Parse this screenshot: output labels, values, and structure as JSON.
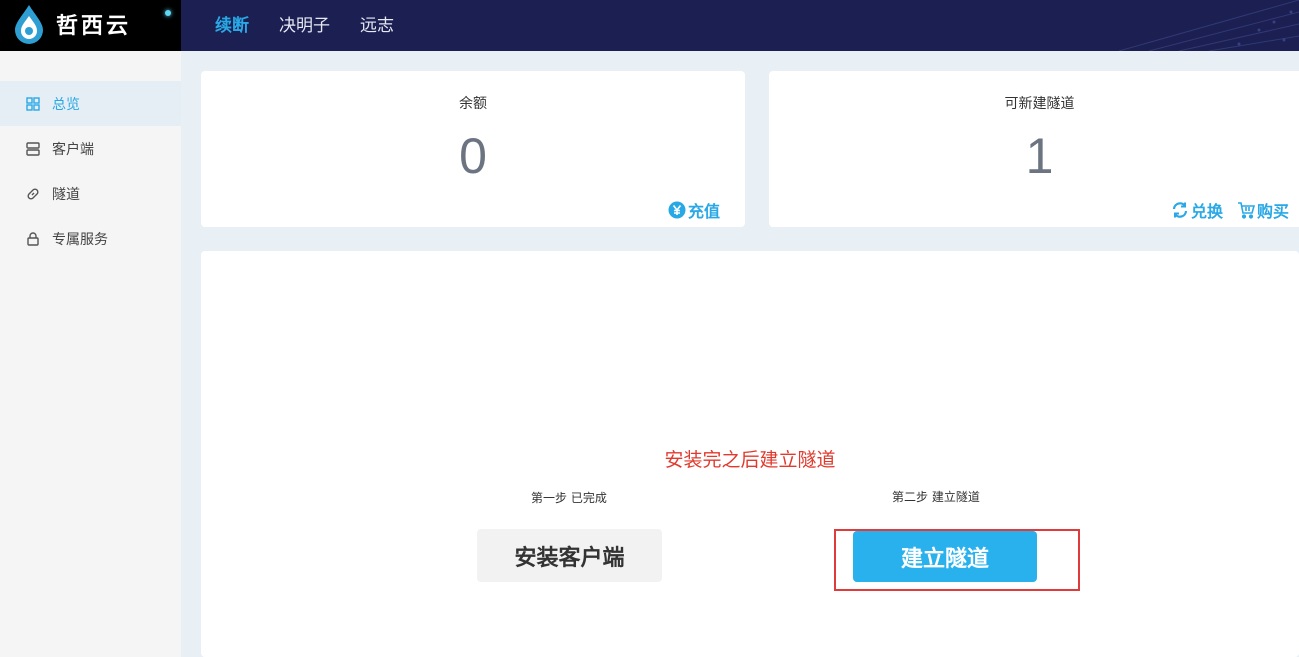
{
  "brand": {
    "name": "哲西云"
  },
  "topnav": {
    "items": [
      {
        "label": "续断",
        "active": true
      },
      {
        "label": "决明子"
      },
      {
        "label": "远志"
      }
    ]
  },
  "sidebar": {
    "items": [
      {
        "label": "总览",
        "icon": "grid-icon",
        "active": true
      },
      {
        "label": "客户端",
        "icon": "server-icon"
      },
      {
        "label": "隧道",
        "icon": "link-icon"
      },
      {
        "label": "专属服务",
        "icon": "lock-icon"
      }
    ]
  },
  "balance_card": {
    "title": "余额",
    "value": "0",
    "recharge_label": "充值"
  },
  "tunnel_card": {
    "title": "可新建隧道",
    "value": "1",
    "exchange_label": "兑换",
    "buy_label": "购买"
  },
  "main": {
    "headline": "安装完之后建立隧道",
    "step1_label": "第一步 已完成",
    "step2_label": "第二步 建立隧道",
    "install_button": "安装客户端",
    "create_button": "建立隧道"
  },
  "colors": {
    "accent": "#29a8e6",
    "topbar": "#1b1f52",
    "headline": "#e03a2e",
    "highlight": "#e03a3a"
  }
}
